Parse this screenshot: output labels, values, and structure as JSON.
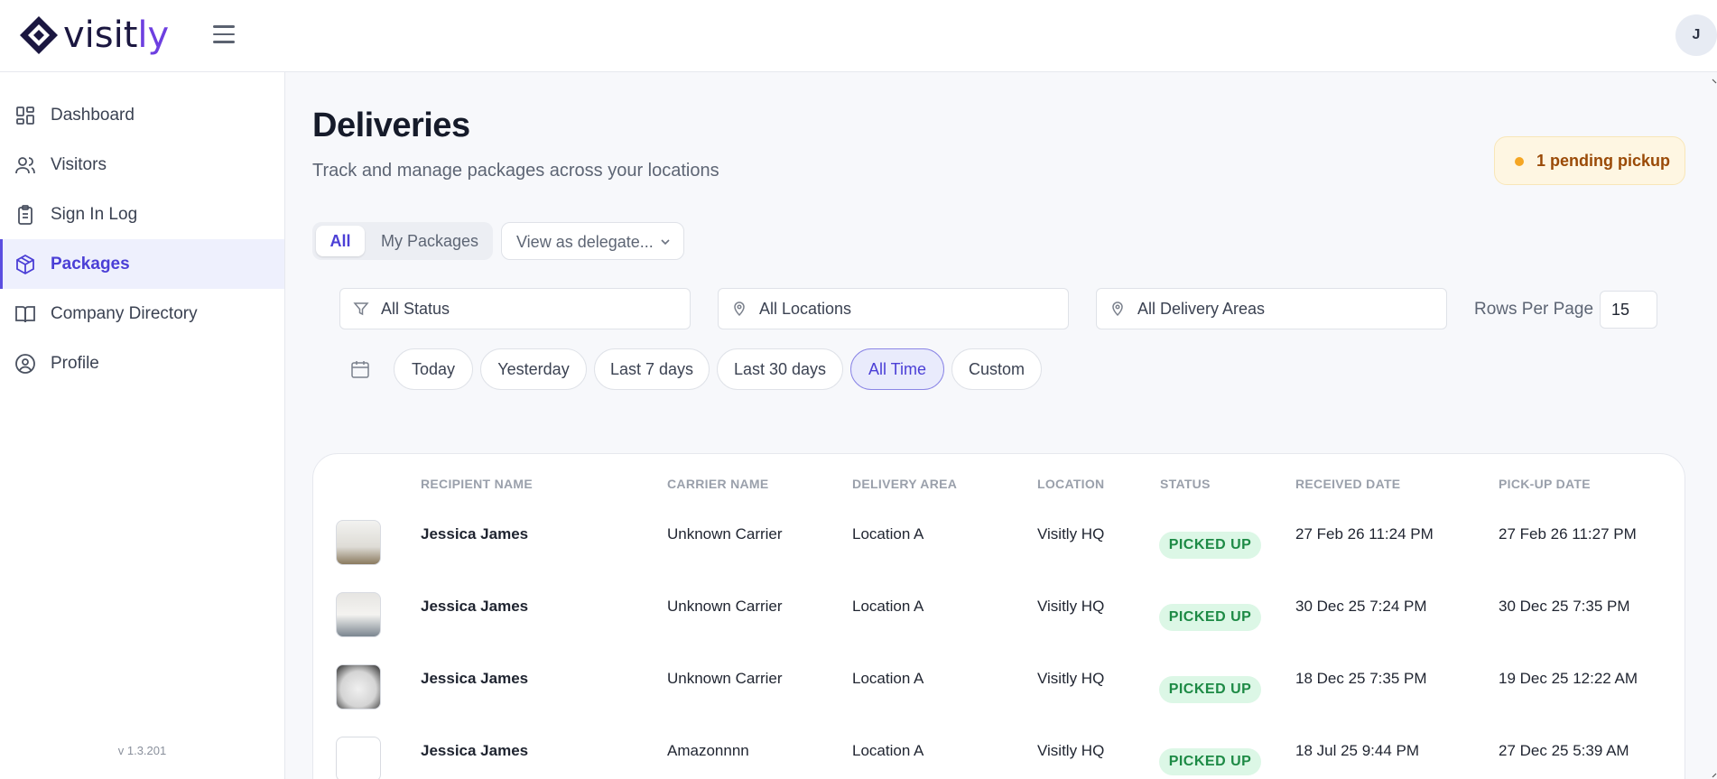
{
  "brand": {
    "name_main": "visit",
    "name_accent": "ly",
    "accent_color": "#6d3fe0"
  },
  "user": {
    "avatar_initial": "J"
  },
  "sidebar": {
    "items": [
      {
        "label": "Dashboard",
        "icon": "dashboard-icon"
      },
      {
        "label": "Visitors",
        "icon": "users-icon"
      },
      {
        "label": "Sign In Log",
        "icon": "clipboard-icon"
      },
      {
        "label": "Packages",
        "icon": "package-icon",
        "active": true
      },
      {
        "label": "Company Directory",
        "icon": "book-icon"
      },
      {
        "label": "Profile",
        "icon": "user-circle-icon"
      }
    ],
    "version": "v 1.3.201"
  },
  "page": {
    "title": "Deliveries",
    "subtitle": "Track and manage packages across your locations",
    "pending_badge": "1 pending pickup"
  },
  "view_toggle": {
    "all": "All",
    "mine": "My Packages",
    "selected": "All"
  },
  "delegate_select": {
    "value": "View as delegate..."
  },
  "filters": {
    "status": "All Status",
    "locations": "All Locations",
    "delivery_areas": "All Delivery Areas",
    "rows_per_page_label": "Rows Per Page",
    "rows_per_page_value": "15"
  },
  "date_ranges": {
    "options": [
      "Today",
      "Yesterday",
      "Last 7 days",
      "Last 30 days",
      "All Time",
      "Custom"
    ],
    "selected": "All Time"
  },
  "table": {
    "columns": [
      "RECIPIENT NAME",
      "CARRIER NAME",
      "DELIVERY AREA",
      "LOCATION",
      "STATUS",
      "RECEIVED DATE",
      "PICK-UP DATE"
    ],
    "rows": [
      {
        "recipient": "Jessica James",
        "carrier": "Unknown Carrier",
        "area": "Location A",
        "location": "Visitly HQ",
        "status": "PICKED UP",
        "received": "27 Feb 26 11:24 PM",
        "pickup": "27 Feb 26 11:27 PM"
      },
      {
        "recipient": "Jessica James",
        "carrier": "Unknown Carrier",
        "area": "Location A",
        "location": "Visitly HQ",
        "status": "PICKED UP",
        "received": "30 Dec 25 7:24 PM",
        "pickup": "30 Dec 25 7:35 PM"
      },
      {
        "recipient": "Jessica James",
        "carrier": "Unknown Carrier",
        "area": "Location A",
        "location": "Visitly HQ",
        "status": "PICKED UP",
        "received": "18 Dec 25 7:35 PM",
        "pickup": "19 Dec 25 12:22 AM"
      },
      {
        "recipient": "Jessica James",
        "carrier": "Amazonnnn",
        "area": "Location A",
        "location": "Visitly HQ",
        "status": "PICKED UP",
        "received": "18 Jul 25 9:44 PM",
        "pickup": "27 Dec 25 5:39 AM"
      }
    ]
  },
  "colors": {
    "primary": "#4b3fd6",
    "success_bg": "#dcf7e6",
    "success_text": "#1d8a45",
    "warning_bg": "#fef6e2",
    "warning_dot": "#f5a623"
  }
}
